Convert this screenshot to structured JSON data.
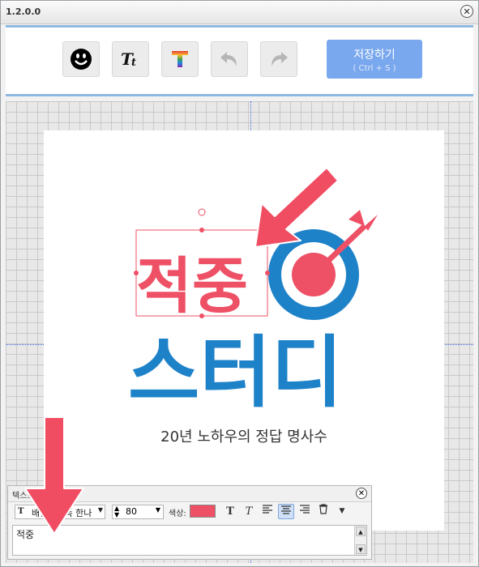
{
  "window": {
    "title": "1.2.0.0",
    "close_symbol": "✕"
  },
  "toolbar": {
    "buttons": [
      {
        "name": "sticker-button",
        "icon": "smiley-icon"
      },
      {
        "name": "text-button",
        "icon": "text-format-icon"
      },
      {
        "name": "color-text-button",
        "icon": "rainbow-text-icon"
      },
      {
        "name": "undo-button",
        "icon": "undo-icon"
      },
      {
        "name": "redo-button",
        "icon": "redo-icon"
      }
    ],
    "save_label": "저장하기",
    "save_shortcut": "( Ctrl + S )",
    "save_color": "#7aa8ee"
  },
  "canvas": {
    "logo_word1": "적중",
    "logo_word2": "스터디",
    "tagline": "20년 노하우의 정답 명사수",
    "red_color": "#ee5065",
    "blue_color": "#1e82c8"
  },
  "text_panel": {
    "title": "텍스트 꾸밀하기",
    "font_name": "배달의민족 한나",
    "font_size": "80",
    "color_label": "색상:",
    "color_value": "#ee5065",
    "text_value": "적중"
  }
}
